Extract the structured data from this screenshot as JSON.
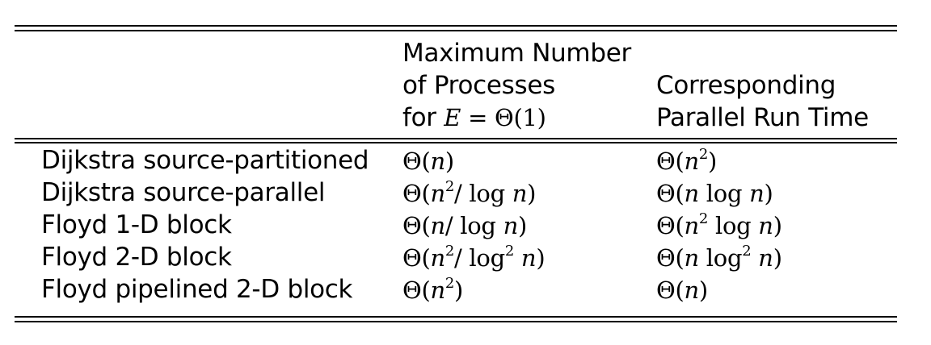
{
  "table": {
    "header": {
      "col2_line1": "Maximum Number",
      "col2_line2": "of Processes",
      "col2_line3_prefix": "for",
      "col2_line3_E": "E",
      "col2_line3_eq": "= Θ(1)",
      "col3_line1": "Corresponding",
      "col3_line2": "Parallel Run Time"
    },
    "rows": [
      {
        "algorithm": "Dijkstra source-partitioned",
        "max_processes": "Θ(n)",
        "run_time": "Θ(n²)"
      },
      {
        "algorithm": "Dijkstra source-parallel",
        "max_processes": "Θ(n²/ log n)",
        "run_time": "Θ(n log n)"
      },
      {
        "algorithm": "Floyd 1-D block",
        "max_processes": "Θ(n/ log n)",
        "run_time": "Θ(n² log n)"
      },
      {
        "algorithm": "Floyd 2-D block",
        "max_processes": "Θ(n²/ log² n)",
        "run_time": "Θ(n log² n)"
      },
      {
        "algorithm": "Floyd pipelined 2-D block",
        "max_processes": "Θ(n²)",
        "run_time": "Θ(n)"
      }
    ]
  }
}
